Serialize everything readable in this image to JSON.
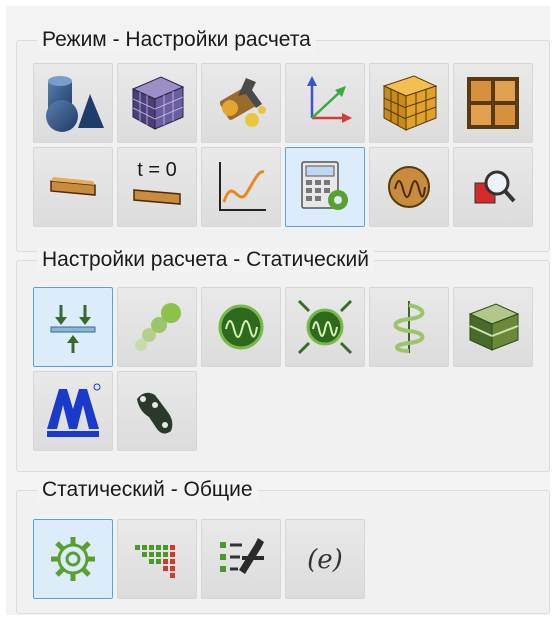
{
  "groups": [
    {
      "title": "Режим - Настройки расчета",
      "buttons": [
        {
          "icon": "geometry-shapes-icon"
        },
        {
          "icon": "mesh-cube-icon"
        },
        {
          "icon": "materials-wrench-icon"
        },
        {
          "icon": "coordinate-axes-icon"
        },
        {
          "icon": "grid-cube-icon"
        },
        {
          "icon": "grid-frame-icon"
        },
        {
          "icon": "beam-element-icon"
        },
        {
          "icon": "initial-conditions-icon",
          "text": "t = 0"
        },
        {
          "icon": "graph-curve-icon"
        },
        {
          "icon": "calculation-settings-icon",
          "selected": true
        },
        {
          "icon": "oscillation-icon"
        },
        {
          "icon": "search-results-icon"
        }
      ]
    },
    {
      "title": "Настройки расчета - Статический",
      "buttons": [
        {
          "icon": "static-loads-icon",
          "selected": true
        },
        {
          "icon": "sphere-chain-icon"
        },
        {
          "icon": "green-oscillator-icon"
        },
        {
          "icon": "oscillator-arrows-icon"
        },
        {
          "icon": "spiral-spring-icon"
        },
        {
          "icon": "layered-box-icon"
        },
        {
          "icon": "automechanics-logo-icon"
        },
        {
          "icon": "chain-link-icon"
        }
      ]
    },
    {
      "title": "Статический - Общие",
      "buttons": [
        {
          "icon": "gear-icon",
          "selected": true
        },
        {
          "icon": "matrix-grid-icon"
        },
        {
          "icon": "list-wrench-icon"
        },
        {
          "icon": "expression-icon",
          "text": "(e)"
        }
      ]
    }
  ]
}
